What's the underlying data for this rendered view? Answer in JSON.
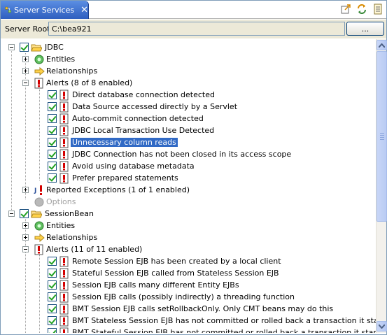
{
  "view": {
    "title": "Server Services",
    "close_glyph": "✕",
    "toolbar_icons": [
      "export-icon",
      "sync-icon",
      "properties-icon"
    ]
  },
  "server_root": {
    "label": "Server Root",
    "value": "C:\\bea921",
    "browse_label": "..."
  },
  "tree": {
    "jdbc": {
      "label": "JDBC",
      "entities": "Entities",
      "relationships": "Relationships",
      "alerts": "Alerts (8 of 8 enabled)",
      "alert_items": [
        "Direct database connection detected",
        "Data Source accessed directly by a Servlet",
        "Auto-commit connection detected",
        "JDBC Local Transaction Use Detected",
        "Unnecessary column reads",
        "JDBC Connection has not been closed in its access scope",
        "Avoid using database metadata",
        "Prefer prepared statements"
      ],
      "reported_exceptions": "Reported Exceptions (1 of 1 enabled)",
      "options": "Options"
    },
    "sessionbean": {
      "label": "SessionBean",
      "entities": "Entities",
      "relationships": "Relationships",
      "alerts": "Alerts (11 of 11 enabled)",
      "alert_items": [
        "Remote Session EJB has been created by a local client",
        "Stateful Session EJB called from Stateless Session EJB",
        "Session EJB calls many different Entity EJBs",
        "Session EJB calls (possibly indirectly) a threading function",
        "BMT Session EJB calls setRollbackOnly. Only CMT beans may do this",
        "BMT Stateless Session EJB has not committed or rolled back a transaction it started",
        "BMT Stateful Session EJB has not committed or rolled back a transaction it started"
      ]
    },
    "selected_item": "Unnecessary column reads"
  },
  "colors": {
    "selection": "#316ac5",
    "tab_active": "#3869c9",
    "check": "#21a121",
    "alert_red": "#d40000"
  }
}
